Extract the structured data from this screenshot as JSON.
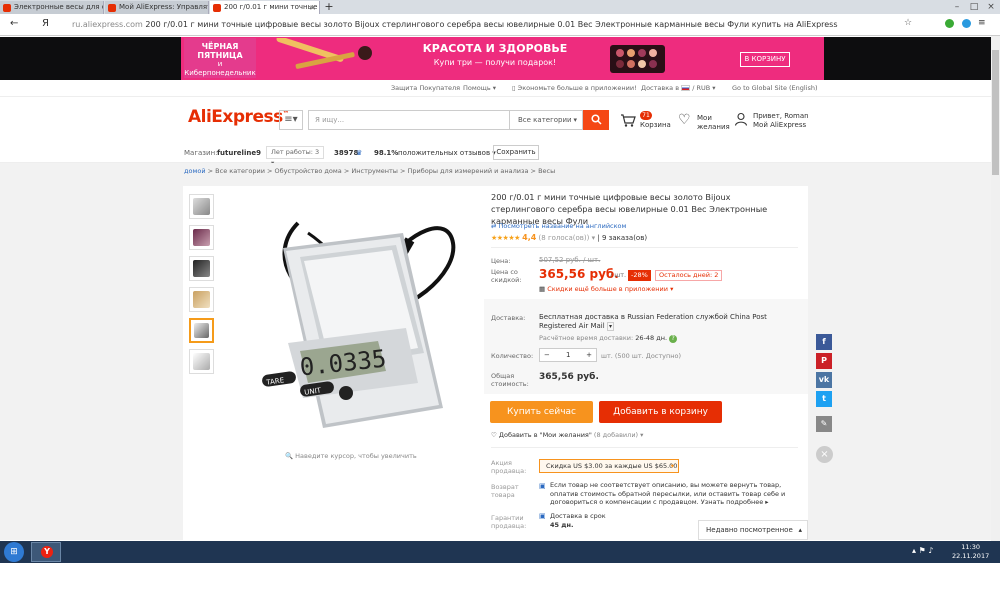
{
  "browser": {
    "tabs": [
      {
        "title": "Электронные весы для смо"
      },
      {
        "title": "Мой AliExpress: Управлять"
      },
      {
        "title": "200 г/0.01 г мини точные"
      }
    ],
    "nav": {
      "back": "←",
      "menu_glyph": "Я"
    },
    "url": {
      "host": "ru.aliexpress.com",
      "text": "200 г/0.01 г мини точные цифровые весы золото Bijoux стерлингового серебра весы ювелирные 0.01 Вес Электронные карманные весы Фули купить на AliExpress"
    }
  },
  "banner": {
    "black_friday": "ЧЁРНАЯ ПЯТНИЦА",
    "and": "и",
    "cyber_monday": "Киберпонедельник",
    "promo_title": "КРАСОТА И ЗДОРОВЬЕ",
    "promo_sub": "Купи три — получи подарок!",
    "cart_button": "В КОРЗИНУ"
  },
  "util": {
    "protection": "Защита Покупателя",
    "help": "Помощь",
    "app": "Экономьте больше в приложении!",
    "delivery": "Доставка в",
    "currency": "RUB",
    "global": "Go to Global Site (English)"
  },
  "header": {
    "logo_main": "AliExpress",
    "logo_tm": "™",
    "search_placeholder": "Я ищу...",
    "category": "Все категории",
    "cart_count": "71",
    "cart_label": "Корзина",
    "wish_line1": "Мои",
    "wish_line2": "желания",
    "user_line1": "Привет, Roman",
    "user_line2": "Мой AliExpress"
  },
  "store": {
    "label": "Магазин:",
    "name": "futureline9",
    "years": "Лет работы: 3",
    "score": "38978",
    "positive_pct": "98.1%",
    "positive_label": "положительных отзывов",
    "save": "Сохранить"
  },
  "breadcrumbs": [
    "домой",
    "Все категории",
    "Обустройство дома",
    "Инструменты",
    "Приборы для измерений и анализа",
    "Весы"
  ],
  "product": {
    "title": "200 г/0.01 г мини точные цифровые весы золото Bijoux стерлингового серебра весы ювелирные 0.01 Вес Электронные карманные весы Фули",
    "translate": "Посмотреть название на английском",
    "rating": "4,4",
    "votes": "(8 голоса(ов))",
    "orders": "9 заказа(ов)",
    "zoom_hint": "Наведите курсор, чтобы увеличить",
    "price_label": "Цена:",
    "old_price": "507,52 руб. / шт.",
    "sale_label_1": "Цена со",
    "sale_label_2": "скидкой:",
    "new_price": "365,56 руб.",
    "per_unit": "/ шт.",
    "discount": "-28%",
    "days_left": "Осталось дней: 2",
    "app_discount": "Скидки ещё больше в приложении",
    "delivery_label": "Доставка:",
    "delivery_value": "Бесплатная доставка в Russian Federation службой China Post Registered Air Mail",
    "delivery_time_label": "Расчётное время доставки:",
    "delivery_time": "26-48 дн.",
    "qty_label": "Количество:",
    "qty_minus": "−",
    "qty_value": "1",
    "qty_plus": "+",
    "qty_note": "шт. (500 шт. Доступно)",
    "total_label_1": "Общая",
    "total_label_2": "стоимость:",
    "total": "365,56 руб.",
    "buy_now": "Купить сейчас",
    "add_cart": "Добавить в корзину",
    "add_wish": "Добавить в \"Мои желания\"",
    "wish_count": "(8 добавили)",
    "promo_label_1": "Акция",
    "promo_label_2": "продавца:",
    "coupon": "Скидка US $3.00 за каждые US $65.00",
    "return_label_1": "Возврат",
    "return_label_2": "товара",
    "return_text": "Если товар не соответствует описанию, вы можете вернуть товар, оплатив стоимость обратной пересылки, или оставить товар себе и договориться о компенсации с продавцом.",
    "return_link": "Узнать подробнее",
    "guarantee_label_1": "Гарантии",
    "guarantee_label_2": "продавца:",
    "guarantee_line1": "Доставка в срок",
    "guarantee_line2": "45 дн.",
    "recently_viewed": "Недавно посмотренное",
    "scale_display": "0.0335",
    "btn_tare": "TARE",
    "btn_unit": "UNIT"
  },
  "taskbar": {
    "time": "11:30",
    "date": "22.11.2017"
  },
  "colors": {
    "accent": "#e62e04",
    "buy_button": "#f7931e",
    "link": "#2b6ac1"
  }
}
